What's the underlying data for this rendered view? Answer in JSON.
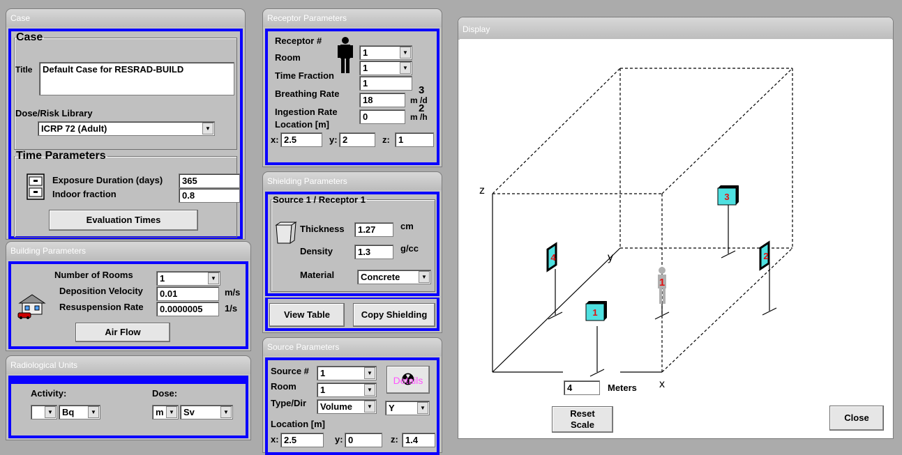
{
  "case_panel": {
    "title": "Case",
    "group_label": "Case",
    "title_label": "Title",
    "title_value": "Default Case for RESRAD-BUILD",
    "library_label": "Dose/Risk Library",
    "library_value": "ICRP 72 (Adult)",
    "time_group_label": "Time Parameters",
    "exposure_label": "Exposure Duration (days)",
    "exposure_value": "365",
    "indoor_label": "Indoor fraction",
    "indoor_value": "0.8",
    "eval_button": "Evaluation Times"
  },
  "building_panel": {
    "title": "Building Parameters",
    "rooms_label": "Number of Rooms",
    "rooms_value": "1",
    "deposition_label": "Deposition Velocity",
    "deposition_value": "0.01",
    "deposition_unit": "m/s",
    "resuspension_label": "Resuspension Rate",
    "resuspension_value": "0.0000005",
    "resuspension_unit": "1/s",
    "airflow_button": "Air Flow"
  },
  "units_panel": {
    "title": "Radiological Units",
    "activity_label": "Activity:",
    "activity_prefix": "",
    "activity_unit": "Bq",
    "dose_label": "Dose:",
    "dose_prefix": "m",
    "dose_unit": "Sv"
  },
  "receptor_panel": {
    "title": "Receptor Parameters",
    "receptor_label": "Receptor #",
    "receptor_value": "1",
    "room_label": "Room",
    "room_value": "1",
    "time_fraction_label": "Time Fraction",
    "time_fraction_value": "1",
    "breathing_label": "Breathing Rate",
    "breathing_value": "18",
    "breathing_unit_exp": "3",
    "breathing_unit": "m /d",
    "ingestion_label": "Ingestion Rate",
    "ingestion_value": "0",
    "ingestion_unit_exp": "2",
    "ingestion_unit": "m /h",
    "location_label": "Location [m]",
    "x_label": "x:",
    "x_value": "2.5",
    "y_label": "y:",
    "y_value": "2",
    "z_label": "z:",
    "z_value": "1"
  },
  "shielding_panel": {
    "title": "Shielding Parameters",
    "group_label": "Source 1 / Receptor 1",
    "thickness_label": "Thickness",
    "thickness_value": "1.27",
    "thickness_unit": "cm",
    "density_label": "Density",
    "density_value": "1.3",
    "density_unit": "g/cc",
    "material_label": "Material",
    "material_value": "Concrete",
    "view_table_button": "View Table",
    "copy_shielding_button": "Copy Shielding"
  },
  "source_panel": {
    "title": "Source Parameters",
    "source_label": "Source #",
    "source_value": "1",
    "room_label": "Room",
    "room_value": "1",
    "type_label": "Type/Dir",
    "type_value": "Volume",
    "dir_value": "Y",
    "details_button": "Details",
    "location_label": "Location [m]",
    "x_label": "x:",
    "x_value": "2.5",
    "y_label": "y:",
    "y_value": "0",
    "z_label": "z:",
    "z_value": "1.4"
  },
  "display_panel": {
    "title": "Display",
    "axis_z": "z",
    "axis_y": "y",
    "axis_x": "x",
    "scale_value": "4",
    "scale_unit": "Meters",
    "reset_scale_button": "Reset\nScale",
    "close_button": "Close",
    "source_markers": [
      "1",
      "2",
      "3",
      "4"
    ],
    "receptor_marker": "1"
  },
  "colors": {
    "accent_border": "#0a00ff",
    "panel_bg": "#c0c0c0",
    "marker_fill": "#4fe0e0",
    "marker_label": "#e01010",
    "receptor_figure": "#b0b0b0"
  }
}
